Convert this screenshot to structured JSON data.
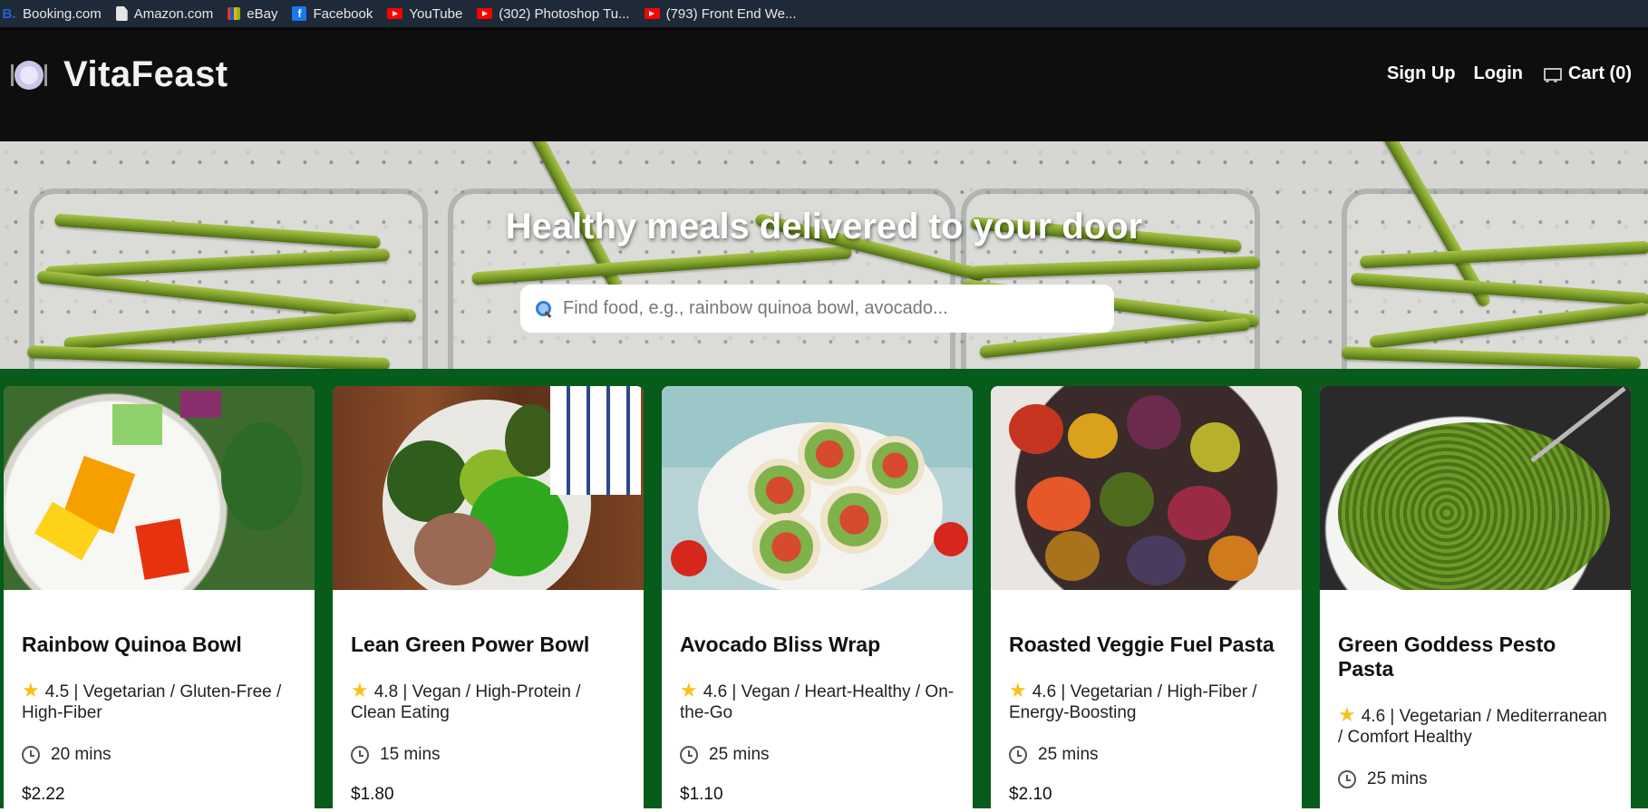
{
  "bookmarks": [
    {
      "label": "Booking.com",
      "icon": "booking-icon"
    },
    {
      "label": "Amazon.com",
      "icon": "page-icon"
    },
    {
      "label": "eBay",
      "icon": "ebay-icon"
    },
    {
      "label": "Facebook",
      "icon": "facebook-icon"
    },
    {
      "label": "YouTube",
      "icon": "youtube-icon"
    },
    {
      "label": "(302) Photoshop Tu...",
      "icon": "youtube-icon"
    },
    {
      "label": "(793) Front End We...",
      "icon": "youtube-icon"
    }
  ],
  "header": {
    "brand": "VitaFeast",
    "nav": {
      "signup": "Sign Up",
      "login": "Login",
      "cart": "Cart (0)"
    }
  },
  "hero": {
    "title": "Healthy meals delivered to your door",
    "search_placeholder": "Find food, e.g., rainbow quinoa bowl, avocado..."
  },
  "cards": [
    {
      "title": "Rainbow Quinoa Bowl",
      "meta": "4.5 | Vegetarian / Gluten-Free / High-Fiber",
      "time": "20 mins",
      "price": "$2.22"
    },
    {
      "title": "Lean Green Power Bowl",
      "meta": "4.8 | Vegan / High-Protein / Clean Eating",
      "time": "15 mins",
      "price": "$1.80"
    },
    {
      "title": "Avocado Bliss Wrap",
      "meta": "4.6 | Vegan / Heart-Healthy / On-the-Go",
      "time": "25 mins",
      "price": "$1.10"
    },
    {
      "title": "Roasted Veggie Fuel Pasta",
      "meta": "4.6 | Vegetarian / High-Fiber / Energy-Boosting",
      "time": "25 mins",
      "price": "$2.10"
    },
    {
      "title": "Green Goddess Pesto Pasta",
      "meta": "4.6 | Vegetarian / Mediterranean / Comfort Healthy",
      "time": "25 mins",
      "price": ""
    }
  ],
  "colors": {
    "bookmarks_bg": "#1f2a38",
    "header_bg": "#0e0e0e",
    "cards_bg": "#075b1b",
    "star": "#f7c21a"
  }
}
